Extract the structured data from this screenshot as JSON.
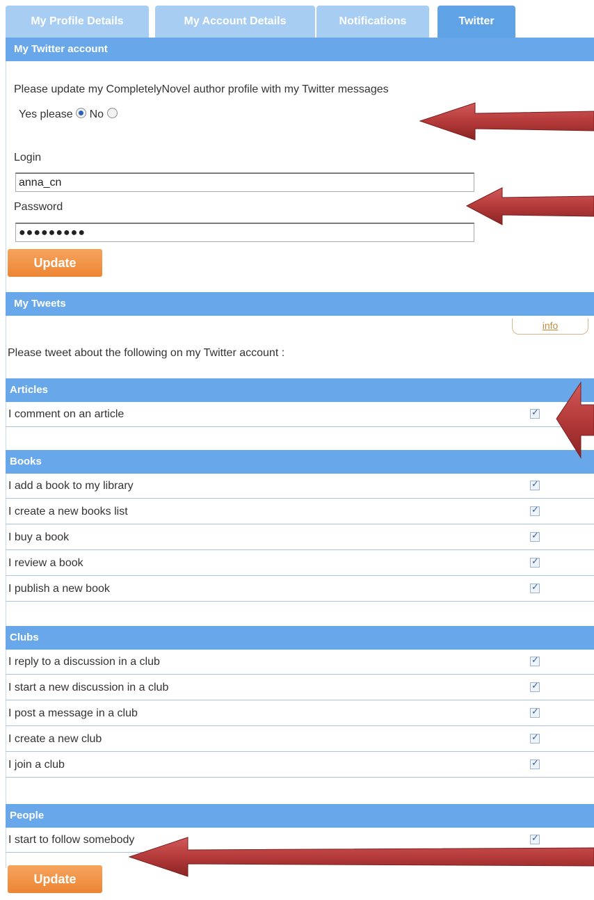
{
  "tabs": [
    {
      "label": "My Profile Details",
      "active": false
    },
    {
      "label": "My Account Details",
      "active": false
    },
    {
      "label": "Notifications",
      "active": false
    },
    {
      "label": "Twitter",
      "active": true
    }
  ],
  "twitter_account": {
    "heading": "My Twitter account",
    "prompt": "Please update my CompletelyNovel author profile with my Twitter messages",
    "yes_label": "Yes please",
    "no_label": "No",
    "selected": "yes",
    "login_label": "Login",
    "login_value": "anna_cn",
    "password_label": "Password",
    "password_value": "●●●●●●●●●",
    "update_label": "Update"
  },
  "tweets": {
    "heading": "My Tweets",
    "info_label": "info",
    "intro": "Please tweet about the following on my Twitter account :",
    "sections": [
      {
        "title": "Articles",
        "items": [
          {
            "label": "I comment on an article",
            "checked": true
          }
        ]
      },
      {
        "title": "Books",
        "items": [
          {
            "label": "I add a book to my library",
            "checked": true
          },
          {
            "label": "I create a new books list",
            "checked": true
          },
          {
            "label": "I buy a book",
            "checked": true
          },
          {
            "label": "I review a book",
            "checked": true
          },
          {
            "label": "I publish a new book",
            "checked": true
          }
        ]
      },
      {
        "title": "Clubs",
        "items": [
          {
            "label": "I reply to a discussion in a club",
            "checked": true
          },
          {
            "label": "I start a new discussion in a club",
            "checked": true
          },
          {
            "label": "I post a message in a club",
            "checked": true
          },
          {
            "label": "I create a new club",
            "checked": true
          },
          {
            "label": "I join a club",
            "checked": true
          }
        ]
      },
      {
        "title": "People",
        "items": [
          {
            "label": "I start to follow somebody",
            "checked": true
          }
        ]
      }
    ],
    "update_label": "Update"
  },
  "colors": {
    "tab_active": "#5fa2e6",
    "tab_inactive": "#a8cdf2",
    "header_bar": "#68a8ea",
    "button": "#ec8533",
    "arrow": "#b53a3a"
  }
}
